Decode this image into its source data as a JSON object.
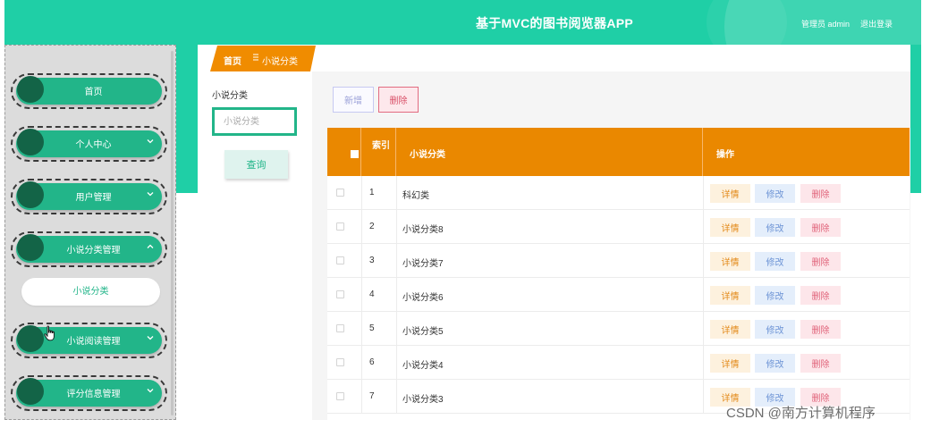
{
  "header": {
    "title": "基于MVC的图书阅览器APP",
    "user": "管理员 admin",
    "logout": "退出登录"
  },
  "sidebar": {
    "items": [
      {
        "label": "首页",
        "has_chevron": false
      },
      {
        "label": "个人中心",
        "has_chevron": true,
        "chevron": "down"
      },
      {
        "label": "用户管理",
        "has_chevron": true,
        "chevron": "down"
      },
      {
        "label": "小说分类管理",
        "has_chevron": true,
        "chevron": "up"
      },
      {
        "label": "小说阅读管理",
        "has_chevron": true,
        "chevron": "down"
      },
      {
        "label": "评分信息管理",
        "has_chevron": true,
        "chevron": "down"
      }
    ],
    "sub_item": "小说分类"
  },
  "breadcrumb": {
    "home": "首页",
    "current": "小说分类"
  },
  "search": {
    "label": "小说分类",
    "placeholder": "小说分类",
    "query_button": "查询"
  },
  "actions": {
    "add": "新增",
    "delete": "删除"
  },
  "table": {
    "headers": {
      "index": "索引",
      "name": "小说分类",
      "ops": "操作"
    },
    "rows": [
      {
        "index": "1",
        "name": "科幻类"
      },
      {
        "index": "2",
        "name": "小说分类8"
      },
      {
        "index": "3",
        "name": "小说分类7"
      },
      {
        "index": "4",
        "name": "小说分类6"
      },
      {
        "index": "5",
        "name": "小说分类5"
      },
      {
        "index": "6",
        "name": "小说分类4"
      },
      {
        "index": "7",
        "name": "小说分类3"
      }
    ],
    "row_actions": {
      "detail": "详情",
      "edit": "修改",
      "delete": "删除"
    }
  },
  "watermark": "CSDN @南方计算机程序",
  "colors": {
    "brand": "#1fcfa6",
    "menu_green": "#22b589",
    "table_header": "#ea8800"
  }
}
